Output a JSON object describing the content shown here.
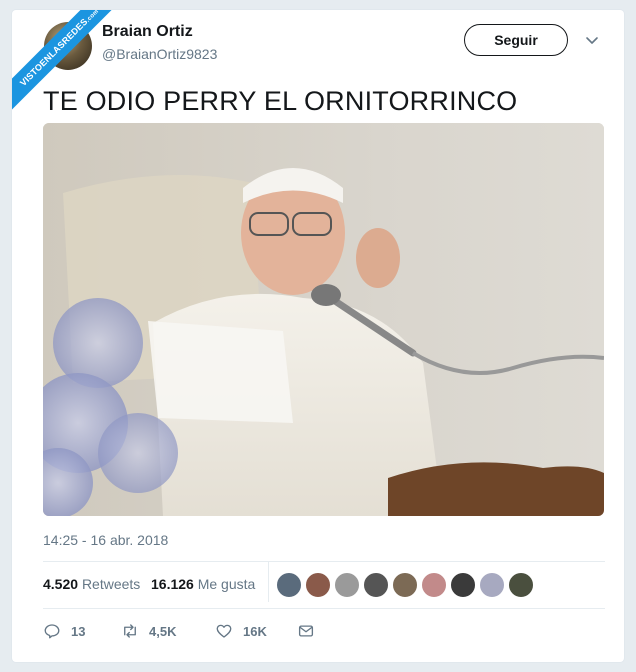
{
  "ribbon": {
    "text": "VISTOENLASREDES",
    "sub": ".com"
  },
  "author": {
    "name": "Braian Ortiz",
    "handle": "@BraianOrtiz9823"
  },
  "follow_label": "Seguir",
  "tweet_text": "TE ODIO PERRY EL ORNITORRINCO",
  "timestamp": "14:25 - 16 abr. 2018",
  "stats": {
    "retweets_count": "4.520",
    "retweets_label": "Retweets",
    "likes_count": "16.126",
    "likes_label": "Me gusta"
  },
  "actions": {
    "replies": "13",
    "retweets": "4,5K",
    "likes": "16K"
  },
  "colors": {
    "accent": "#1b95e0",
    "text": "#14171a",
    "muted": "#657786"
  },
  "icons": [
    "chevron-down-icon",
    "reply-icon",
    "retweet-icon",
    "heart-icon",
    "direct-message-icon"
  ]
}
